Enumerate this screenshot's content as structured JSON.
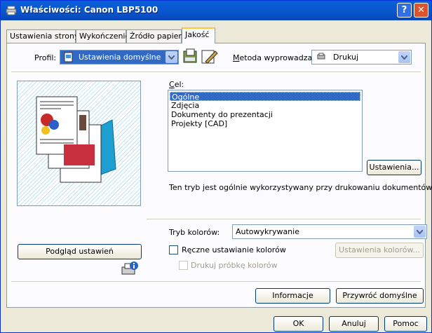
{
  "window": {
    "title": "Właściwości: Canon LBP5100",
    "help_btn": "?",
    "close_btn": "✕"
  },
  "tabs": [
    {
      "label": "Ustawienia strony"
    },
    {
      "label": "Wykończenie"
    },
    {
      "label": "Źródło papieru"
    },
    {
      "label": "Jakość"
    }
  ],
  "profile": {
    "label": "Profil:",
    "value": "Ustawienia domyślne"
  },
  "output_method": {
    "label": "Metoda wyprowadzania:",
    "value": "Drukuj"
  },
  "target": {
    "label": "Cel:",
    "items": [
      "Ogólne",
      "Zdjęcia",
      "Dokumenty do prezentacji",
      "Projekty [CAD]"
    ],
    "selected_index": 0,
    "settings_button": "Ustawienia...",
    "description": "Ten tryb jest ogólnie wykorzystywany przy drukowaniu dokumentów."
  },
  "color_mode": {
    "label": "Tryb kolorów:",
    "value": "Autowykrywanie"
  },
  "manual_color": {
    "label": "Ręczne ustawianie kolorów",
    "checked": false,
    "settings_button": "Ustawienia kolorów..."
  },
  "print_sample": {
    "label": "Drukuj próbkę kolorów",
    "checked": false
  },
  "preview_button": "Podgląd ustawień",
  "info_button": "Informacje",
  "restore_button": "Przywróć domyślne",
  "ok_button": "OK",
  "cancel_button": "Anuluj",
  "help_button": "Pomoc"
}
